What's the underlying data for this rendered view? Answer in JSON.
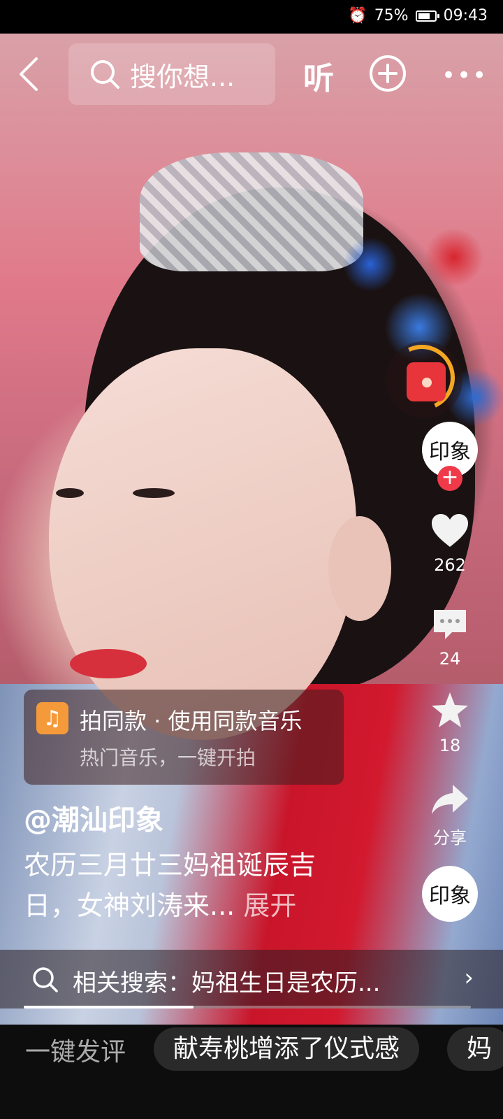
{
  "status_bar": {
    "battery": "75%",
    "time": "09:43",
    "battery_level": 0.75
  },
  "top_bar": {
    "search_placeholder": "搜你想...",
    "listen_label": "听"
  },
  "sidebar": {
    "likes": "262",
    "comments": "24",
    "favorites": "18",
    "share_label": "分享",
    "avatar_text": "印象"
  },
  "music_card": {
    "title": "拍同款 · 使用同款音乐",
    "subtitle": "热门音乐，一键开拍"
  },
  "post": {
    "author": "@潮汕印象",
    "description": "农历三月廿三妈祖诞辰吉日，女神刘涛来...",
    "expand_label": "展开"
  },
  "related_search": {
    "label": "相关搜索：妈祖生日是农历..."
  },
  "video_progress": 0.38,
  "bottom_bar": {
    "quick_comment": "一键发评",
    "chips": [
      "献寿桃增添了仪式感",
      "妈"
    ]
  },
  "colors": {
    "accent_red": "#f03a4a",
    "music_orange": "#f59a3a"
  }
}
